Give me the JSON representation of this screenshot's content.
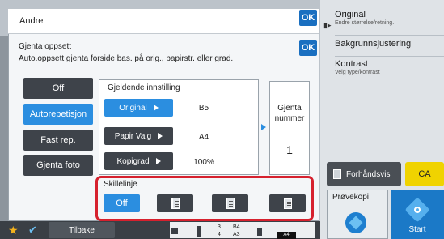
{
  "header": {
    "title": "Andre",
    "ok_label": "OK"
  },
  "section": {
    "title": "Gjenta oppsett",
    "description": "Auto.oppsett gjenta forside bas. på orig., papirstr. eller grad.",
    "ok_label": "OK"
  },
  "modes": [
    {
      "label": "Off",
      "selected": false
    },
    {
      "label": "Autorepetisjon",
      "selected": true
    },
    {
      "label": "Fast rep.",
      "selected": false
    },
    {
      "label": "Gjenta foto",
      "selected": false
    }
  ],
  "current_settings": {
    "label": "Gjeldende innstilling",
    "rows": [
      {
        "button": "Original",
        "value": "B5",
        "selected": true
      },
      {
        "button": "Papir Valg",
        "value": "A4",
        "selected": false
      },
      {
        "button": "Kopigrad",
        "value": "100%",
        "selected": false
      }
    ]
  },
  "repeat": {
    "label_line1": "Gjenta",
    "label_line2": "nummer",
    "value": "1"
  },
  "separator": {
    "label": "Skillelinje",
    "options": [
      {
        "label": "Off",
        "icon": "page-none-icon",
        "selected": true
      },
      {
        "label": "",
        "icon": "page-line-left-icon",
        "selected": false
      },
      {
        "label": "",
        "icon": "page-line-center-icon",
        "selected": false
      },
      {
        "label": "",
        "icon": "page-cross-icon",
        "selected": false
      }
    ]
  },
  "right_panel": {
    "items": [
      {
        "title": "Original",
        "subtitle": "Endre størrelse/retning."
      },
      {
        "title": "Bakgrunnsjustering",
        "subtitle": ""
      },
      {
        "title": "Kontrast",
        "subtitle": "Velg type/kontrast"
      }
    ],
    "preview_label": "Forhåndsvis",
    "ca_label": "CA",
    "proof_label": "Prøvekopi",
    "start_label": "Start"
  },
  "bottom": {
    "back_label": "Tilbake",
    "status": {
      "c1": "3",
      "c2": "4",
      "c3": "B4",
      "c4": "A3",
      "tag": "A4"
    }
  },
  "colors": {
    "accent": "#2b8ee0",
    "ok": "#1a6fc0",
    "highlight": "#d6212e",
    "ca": "#f0d300",
    "start": "#1b79c7"
  }
}
